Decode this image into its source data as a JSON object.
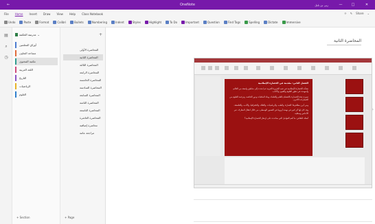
{
  "window": {
    "title": "OneNote",
    "account": "ربى بن بلبل",
    "back_symbol": "←",
    "minimize_symbol": "—",
    "maximize_symbol": "□",
    "close_symbol": "✕"
  },
  "menu": {
    "tabs": [
      "File",
      "Home",
      "Insert",
      "Draw",
      "View",
      "Help",
      "Class Notebook"
    ],
    "active_index": 1,
    "right_tools": [
      "☼",
      "✎",
      "Share",
      "⌄"
    ]
  },
  "ribbon": {
    "items": [
      {
        "label": "Undo",
        "icon": "undo-icon",
        "color": "grey"
      },
      {
        "label": "Paste",
        "icon": "paste-icon",
        "color": "blue"
      },
      {
        "label": "Format",
        "icon": "format-icon",
        "color": "grey"
      },
      {
        "label": "Calibri",
        "icon": "font-icon",
        "color": "blue"
      },
      {
        "label": "Bullets",
        "icon": "bullets-icon",
        "color": "blue"
      },
      {
        "label": "Numbering",
        "icon": "numbering-icon",
        "color": "blue"
      },
      {
        "label": "Indent",
        "icon": "indent-icon",
        "color": "blue"
      },
      {
        "label": "Styles",
        "icon": "styles-icon",
        "color": "purple"
      },
      {
        "label": "Highlight",
        "icon": "highlight-icon",
        "color": "purple"
      },
      {
        "label": "To Do",
        "icon": "todo-icon",
        "color": "blue"
      },
      {
        "label": "Important",
        "icon": "important-icon",
        "color": "purple"
      },
      {
        "label": "Question",
        "icon": "question-icon",
        "color": "blue"
      },
      {
        "label": "Find Tags",
        "icon": "find-tags-icon",
        "color": "blue"
      },
      {
        "label": "Spelling",
        "icon": "spelling-icon",
        "color": "green"
      },
      {
        "label": "Dictate",
        "icon": "dictate-icon",
        "color": "blue"
      },
      {
        "label": "Immersive",
        "icon": "immersive-icon",
        "color": "green"
      }
    ]
  },
  "notebook": {
    "name": "مدرسة الحكمة",
    "expand_symbol": "⌄",
    "sections": [
      {
        "label": "أوراق المعلمين",
        "color": "#4a7bd0"
      },
      {
        "label": "مساحة التعاون",
        "color": "#e06a3a"
      },
      {
        "label": "مكتبة المحتوى",
        "color": "#2f9d8f"
      },
      {
        "label": "اللغة العربية",
        "color": "#d04a7a"
      },
      {
        "label": "التاريخ",
        "color": "#8a55c7"
      },
      {
        "label": "الرياضيات",
        "color": "#e8b224"
      },
      {
        "label": "العلوم",
        "color": "#2e7fce"
      }
    ],
    "selected_section": 2
  },
  "pages": {
    "add_symbol": "+",
    "items": [
      "المحاضرة الأولى",
      "المحاضرة الثانية",
      "المحاضرة الثالثة",
      "المحاضرة الرابعة",
      "المحاضرة الخامسة",
      "المحاضرة السادسة",
      "المحاضرة السابعة",
      "المحاضرة الثامنة",
      "المحاضرة التاسعة",
      "المحاضرة العاشرة",
      "محاضرة إضافية",
      "مراجعة عامة"
    ],
    "selected_page": 1
  },
  "footer": {
    "add_section": "+ Section",
    "add_page": "+ Page"
  },
  "page": {
    "title": "المحاضرة الثانية",
    "chevron_symbol": "›",
    "embedded_slide": {
      "heading": "الفصل الثاني: مقدمة في الحضارة الإسلامية",
      "paragraphs": [
        "نشأت الحضارة الإسلامية في شبه الجزيرة العربية ثم امتدت إلى مناطق واسعة من العالم، وأسهمت في تطور العلوم والفنون والآداب.",
        "تميزت هذه الحضارة بالاهتمام بالعلم والعلماء، وبناء المكتبات ودور الحكمة، وترجمة العلوم من الحضارات الأخرى.",
        "ومن أبرز مظاهرها: العمارة، والطب، والرياضيات، والفلك، والجغرافيا، والأدب، والفلسفة.",
        "وقد كان لها أثر كبير في نهضة أوروبا في العصور الوسطى، من خلال انتقال المعارف عبر الأندلس وصقلية.",
        "أسئلة للنقاش: ما أهم العوامل التي ساعدت على ازدهار الحضارة الإسلامية؟"
      ]
    }
  }
}
